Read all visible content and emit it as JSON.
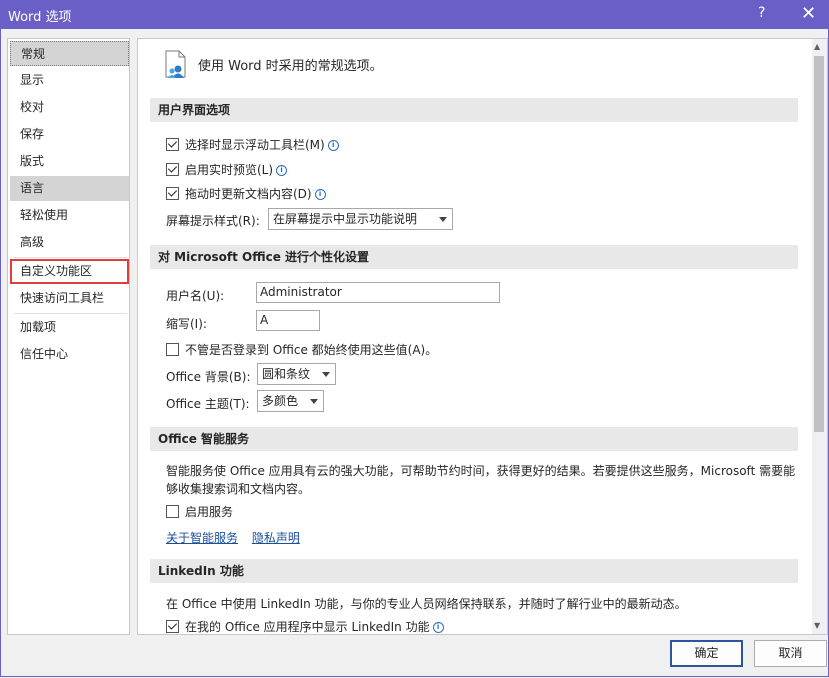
{
  "window": {
    "title": "Word 选项",
    "help": "?",
    "close": "✕"
  },
  "sidebar": {
    "items": [
      {
        "label": "常规"
      },
      {
        "label": "显示"
      },
      {
        "label": "校对"
      },
      {
        "label": "保存"
      },
      {
        "label": "版式"
      },
      {
        "label": "语言"
      },
      {
        "label": "轻松使用"
      },
      {
        "label": "高级"
      },
      {
        "label": "自定义功能区"
      },
      {
        "label": "快速访问工具栏"
      },
      {
        "label": "加载项"
      },
      {
        "label": "信任中心"
      }
    ]
  },
  "main": {
    "header": "使用 Word 时采用的常规选项。",
    "ui_section": {
      "title": "用户界面选项",
      "show_minitoolbar": "选择时显示浮动工具栏(M)",
      "live_preview": "启用实时预览(L)",
      "update_drag": "拖动时更新文档内容(D)",
      "screentip_label": "屏幕提示样式(R):",
      "screentip_value": "在屏幕提示中显示功能说明"
    },
    "personalize_section": {
      "title": "对 Microsoft Office 进行个性化设置",
      "username_label": "用户名(U):",
      "username_value": "Administrator",
      "initials_label": "缩写(I):",
      "initials_value": "A",
      "always_use": "不管是否登录到 Office 都始终使用这些值(A)。",
      "background_label": "Office 背景(B):",
      "background_value": "圆和条纹",
      "theme_label": "Office 主题(T):",
      "theme_value": "多颜色"
    },
    "intelligent_section": {
      "title": "Office 智能服务",
      "description": "智能服务使 Office 应用具有云的强大功能，可帮助节约时间，获得更好的结果。若要提供这些服务，Microsoft 需要能够收集搜索词和文档内容。",
      "enable": "启用服务",
      "about_link": "关于智能服务",
      "privacy_link": "隐私声明"
    },
    "linkedin_section": {
      "title": "LinkedIn 功能",
      "description": "在 Office 中使用 LinkedIn 功能，与你的专业人员网络保持联系，并随时了解行业中的最新动态。",
      "show_features": "在我的 Office 应用程序中显示 LinkedIn 功能"
    }
  },
  "footer": {
    "ok": "确定",
    "cancel": "取消"
  }
}
